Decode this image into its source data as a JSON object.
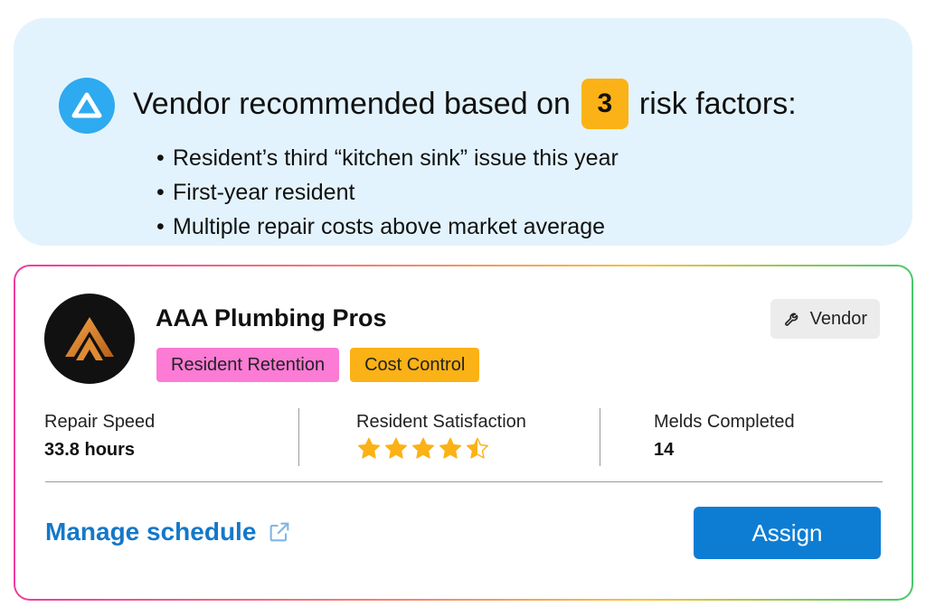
{
  "recommendation": {
    "title_prefix": "Vendor recommended based on",
    "risk_count": "3",
    "title_suffix": "risk factors:",
    "logo_icon": "triangle-logo-icon",
    "factors": [
      "Resident’s third “kitchen sink” issue this year",
      "First-year resident",
      "Multiple repair costs above market average"
    ]
  },
  "vendor": {
    "name": "AAA Plumbing Pros",
    "avatar_icon": "chevron-peak-logo-icon",
    "tags": [
      {
        "label": "Resident Retention",
        "color": "#fb7bd5"
      },
      {
        "label": "Cost Control",
        "color": "#fbb216"
      }
    ],
    "badge": {
      "label": "Vendor",
      "icon": "wrench-icon"
    },
    "stats": {
      "repair_speed": {
        "label": "Repair Speed",
        "value": "33.8 hours"
      },
      "resident_satisfaction": {
        "label": "Resident Satisfaction",
        "rating": 4.5,
        "max": 5
      },
      "melds_completed": {
        "label": "Melds Completed",
        "value": "14"
      }
    }
  },
  "actions": {
    "manage_label": "Manage schedule",
    "manage_icon": "external-link-icon",
    "assign_label": "Assign"
  },
  "colors": {
    "accent": "#0d7dd4",
    "link": "#1478c9",
    "star": "#fbb216",
    "banner_bg": "#e3f3fd"
  }
}
